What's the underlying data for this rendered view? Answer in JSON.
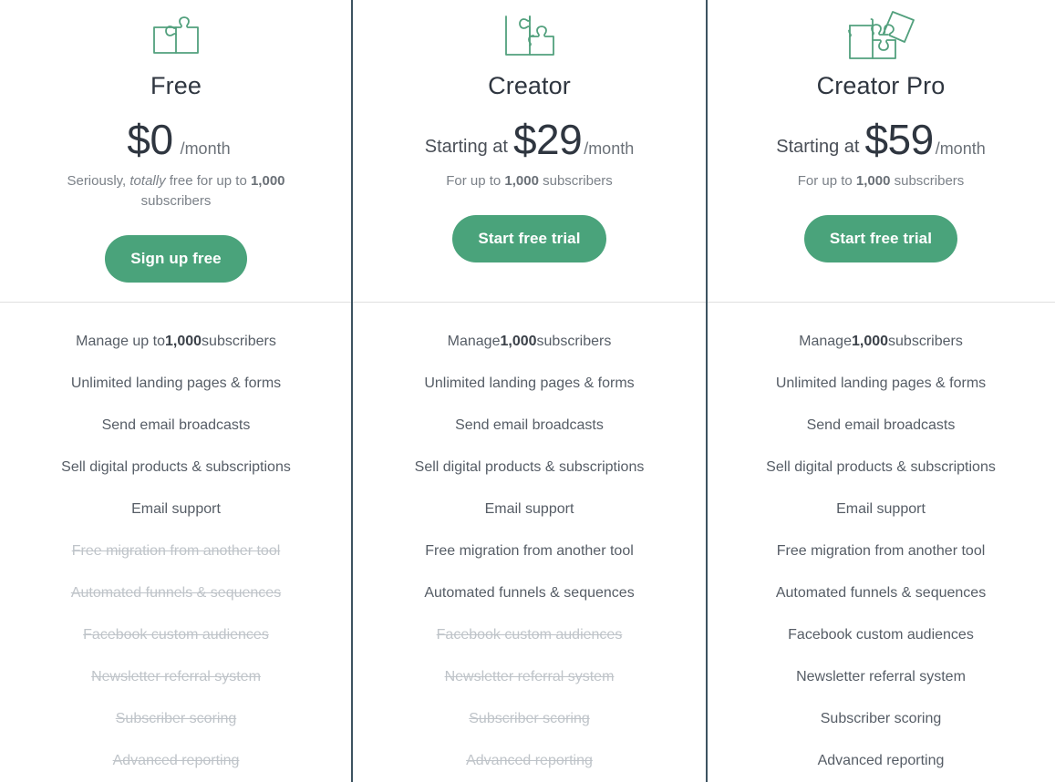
{
  "theme": {
    "accent_green": "#4aa37b",
    "icon_green": "#52a07d",
    "divider_vertical": "#3d5361",
    "divider_horizontal": "#e0e0e0",
    "text_primary": "#2f3640",
    "text_muted": "#7b8188",
    "text_disabled": "#bfc4c9"
  },
  "plans": [
    {
      "id": "free",
      "icon": "puzzle-two-pieces-icon",
      "name": "Free",
      "price_prefix": "",
      "price_amount": "$0",
      "price_period": "/month",
      "note_pre": "Seriously, ",
      "note_italic": "totally",
      "note_mid": " free for up to ",
      "note_bold": "1,000",
      "note_post": " subscribers",
      "cta_label": "Sign up free",
      "features": [
        {
          "pre": "Manage up to ",
          "bold": "1,000",
          "post": " subscribers",
          "enabled": true
        },
        {
          "pre": "Unlimited landing pages & forms",
          "bold": "",
          "post": "",
          "enabled": true
        },
        {
          "pre": "Send email broadcasts",
          "bold": "",
          "post": "",
          "enabled": true
        },
        {
          "pre": "Sell digital products & subscriptions",
          "bold": "",
          "post": "",
          "enabled": true
        },
        {
          "pre": "Email support",
          "bold": "",
          "post": "",
          "enabled": true
        },
        {
          "pre": "Free migration from another tool",
          "bold": "",
          "post": "",
          "enabled": false
        },
        {
          "pre": "Automated funnels & sequences",
          "bold": "",
          "post": "",
          "enabled": false
        },
        {
          "pre": "Facebook custom audiences",
          "bold": "",
          "post": "",
          "enabled": false
        },
        {
          "pre": "Newsletter referral system",
          "bold": "",
          "post": "",
          "enabled": false
        },
        {
          "pre": "Subscriber scoring",
          "bold": "",
          "post": "",
          "enabled": false
        },
        {
          "pre": "Advanced reporting",
          "bold": "",
          "post": "",
          "enabled": false
        }
      ]
    },
    {
      "id": "creator",
      "icon": "puzzle-three-pieces-icon",
      "name": "Creator",
      "price_prefix": "Starting at",
      "price_amount": "$29",
      "price_period": "/month",
      "note_pre": "For up to ",
      "note_italic": "",
      "note_mid": "",
      "note_bold": "1,000",
      "note_post": " subscribers",
      "cta_label": "Start free trial",
      "features": [
        {
          "pre": "Manage ",
          "bold": "1,000",
          "post": " subscribers",
          "enabled": true
        },
        {
          "pre": "Unlimited landing pages & forms",
          "bold": "",
          "post": "",
          "enabled": true
        },
        {
          "pre": "Send email broadcasts",
          "bold": "",
          "post": "",
          "enabled": true
        },
        {
          "pre": "Sell digital products & subscriptions",
          "bold": "",
          "post": "",
          "enabled": true
        },
        {
          "pre": "Email support",
          "bold": "",
          "post": "",
          "enabled": true
        },
        {
          "pre": "Free migration from another tool",
          "bold": "",
          "post": "",
          "enabled": true
        },
        {
          "pre": "Automated funnels & sequences",
          "bold": "",
          "post": "",
          "enabled": true
        },
        {
          "pre": "Facebook custom audiences",
          "bold": "",
          "post": "",
          "enabled": false
        },
        {
          "pre": "Newsletter referral system",
          "bold": "",
          "post": "",
          "enabled": false
        },
        {
          "pre": "Subscriber scoring",
          "bold": "",
          "post": "",
          "enabled": false
        },
        {
          "pre": "Advanced reporting",
          "bold": "",
          "post": "",
          "enabled": false
        }
      ]
    },
    {
      "id": "creator-pro",
      "icon": "puzzle-four-pieces-icon",
      "name": "Creator Pro",
      "price_prefix": "Starting at",
      "price_amount": "$59",
      "price_period": "/month",
      "note_pre": "For up to ",
      "note_italic": "",
      "note_mid": "",
      "note_bold": "1,000",
      "note_post": " subscribers",
      "cta_label": "Start free trial",
      "features": [
        {
          "pre": "Manage ",
          "bold": "1,000",
          "post": " subscribers",
          "enabled": true
        },
        {
          "pre": "Unlimited landing pages & forms",
          "bold": "",
          "post": "",
          "enabled": true
        },
        {
          "pre": "Send email broadcasts",
          "bold": "",
          "post": "",
          "enabled": true
        },
        {
          "pre": "Sell digital products & subscriptions",
          "bold": "",
          "post": "",
          "enabled": true
        },
        {
          "pre": "Email support",
          "bold": "",
          "post": "",
          "enabled": true
        },
        {
          "pre": "Free migration from another tool",
          "bold": "",
          "post": "",
          "enabled": true
        },
        {
          "pre": "Automated funnels & sequences",
          "bold": "",
          "post": "",
          "enabled": true
        },
        {
          "pre": "Facebook custom audiences",
          "bold": "",
          "post": "",
          "enabled": true
        },
        {
          "pre": "Newsletter referral system",
          "bold": "",
          "post": "",
          "enabled": true
        },
        {
          "pre": "Subscriber scoring",
          "bold": "",
          "post": "",
          "enabled": true
        },
        {
          "pre": "Advanced reporting",
          "bold": "",
          "post": "",
          "enabled": true
        }
      ]
    }
  ]
}
